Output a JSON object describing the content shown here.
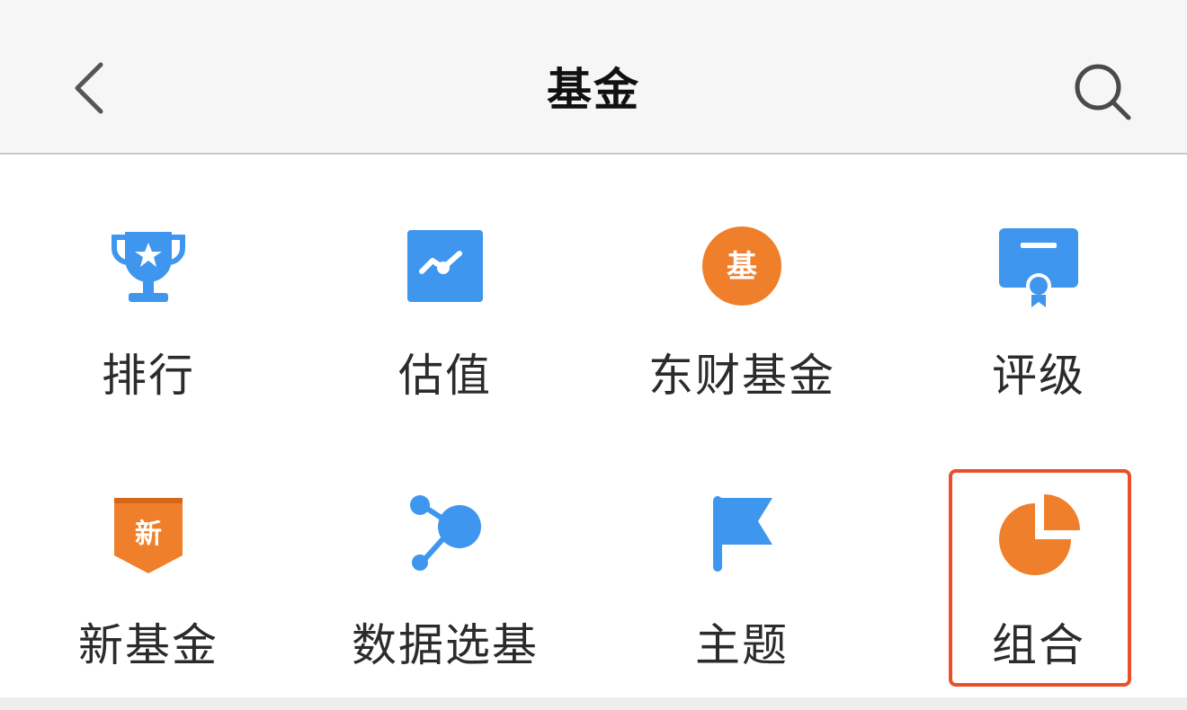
{
  "header": {
    "title": "基金",
    "back_icon": "chevron-left-icon",
    "search_icon": "search-icon"
  },
  "colors": {
    "blue": "#3f96ef",
    "orange": "#ef7f2a",
    "highlight": "#ea4f2b"
  },
  "menu": [
    {
      "label": "排行",
      "icon": "trophy-icon"
    },
    {
      "label": "估值",
      "icon": "trend-chart-icon"
    },
    {
      "label": "东财基金",
      "icon": "fund-badge-icon",
      "icon_text": "基"
    },
    {
      "label": "评级",
      "icon": "certificate-icon"
    },
    {
      "label": "新基金",
      "icon": "new-tag-icon",
      "icon_text": "新"
    },
    {
      "label": "数据选基",
      "icon": "data-nodes-icon"
    },
    {
      "label": "主题",
      "icon": "flag-icon"
    },
    {
      "label": "组合",
      "icon": "pie-chart-icon"
    }
  ]
}
